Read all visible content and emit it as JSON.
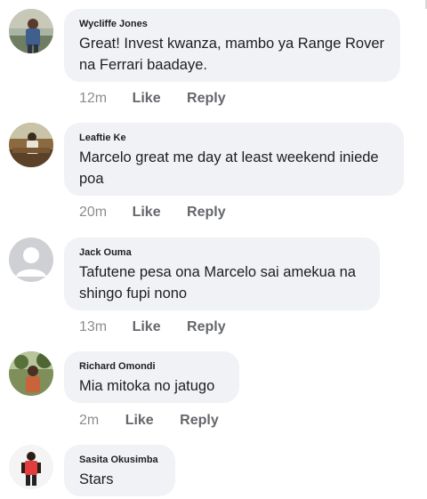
{
  "comments": [
    {
      "author": "Wycliffe Jones",
      "text": "Great! Invest kwanza, mambo ya Range Rover na Ferrari baadaye.",
      "time": "12m",
      "like_label": "Like",
      "reply_label": "Reply",
      "avatar": "wycliffe-avatar"
    },
    {
      "author": "Leaftie Ke",
      "text": "Marcelo great me day at least weekend iniede poa",
      "time": "20m",
      "like_label": "Like",
      "reply_label": "Reply",
      "avatar": "leaftie-avatar"
    },
    {
      "author": "Jack Ouma",
      "text": "Tafutene pesa ona Marcelo sai amekua na shingo fupi nono",
      "time": "13m",
      "like_label": "Like",
      "reply_label": "Reply",
      "avatar": "default-person-icon"
    },
    {
      "author": "Richard Omondi",
      "text": "Mia mitoka no jatugo",
      "time": "2m",
      "like_label": "Like",
      "reply_label": "Reply",
      "avatar": "richard-avatar"
    },
    {
      "author": "Sasita Okusimba",
      "text": "Stars",
      "time": "",
      "like_label": "",
      "reply_label": "",
      "avatar": "sasita-avatar"
    }
  ],
  "colors": {
    "bubble": "#f0f2f5",
    "meta": "#65676b",
    "text": "#1c1e21"
  }
}
